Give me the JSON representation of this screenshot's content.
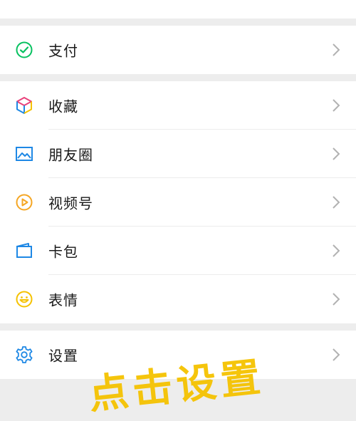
{
  "menu": {
    "pay": {
      "label": "支付",
      "icon": "pay-icon",
      "color": "#07c160"
    },
    "favorites": {
      "label": "收藏",
      "icon": "favorites-cube-icon"
    },
    "moments": {
      "label": "朋友圈",
      "icon": "image-icon",
      "color": "#1e88e5"
    },
    "channels": {
      "label": "视频号",
      "icon": "play-circle-icon",
      "color": "#f5a623"
    },
    "cards": {
      "label": "卡包",
      "icon": "wallet-icon",
      "color": "#1e88e5"
    },
    "stickers": {
      "label": "表情",
      "icon": "smiley-icon",
      "color": "#f5c200"
    },
    "settings": {
      "label": "设置",
      "icon": "gear-icon",
      "color": "#1e88e5"
    }
  },
  "overlay": {
    "text": "点击设置"
  }
}
